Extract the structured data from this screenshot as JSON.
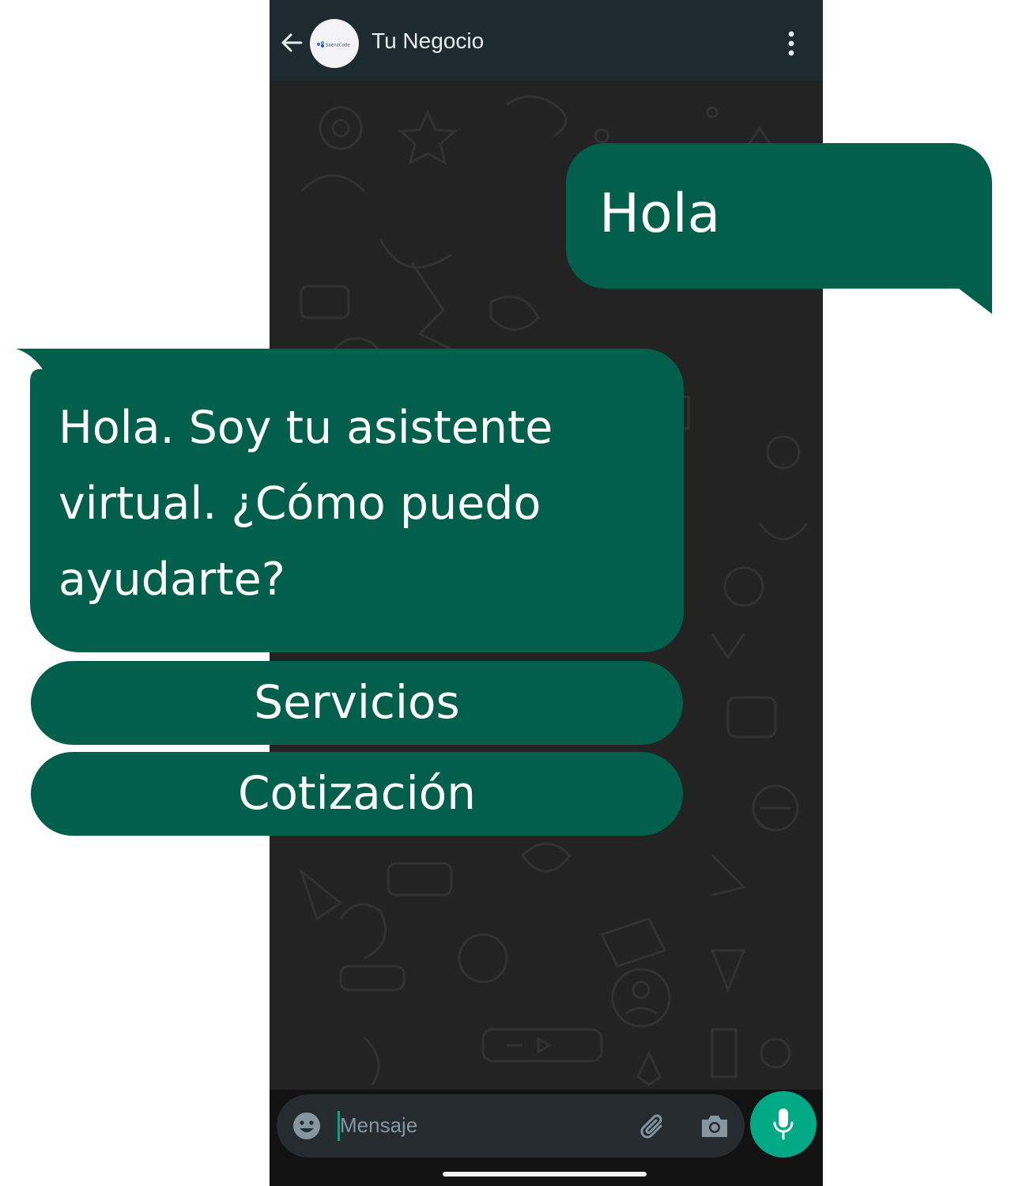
{
  "header": {
    "contact_name": "Tu Negocio",
    "avatar_logo_text": "SaenzCode"
  },
  "messages": [
    {
      "direction": "outgoing",
      "text": "Hola"
    },
    {
      "direction": "incoming",
      "text": "Hola. Soy tu asistente virtual. ¿Cómo puedo ayudarte?"
    }
  ],
  "quick_replies": [
    {
      "label": "Servicios"
    },
    {
      "label": "Cotización"
    }
  ],
  "input": {
    "placeholder": "Mensaje"
  },
  "icons": {
    "back": "arrow-left-icon",
    "menu": "more-vertical-icon",
    "emoji": "emoji-icon",
    "attach": "paperclip-icon",
    "camera": "camera-icon",
    "mic": "microphone-icon"
  },
  "colors": {
    "bubble": "#015f4b",
    "header": "#1d2a30",
    "accent": "#00a884",
    "chat_background": "#232323"
  }
}
